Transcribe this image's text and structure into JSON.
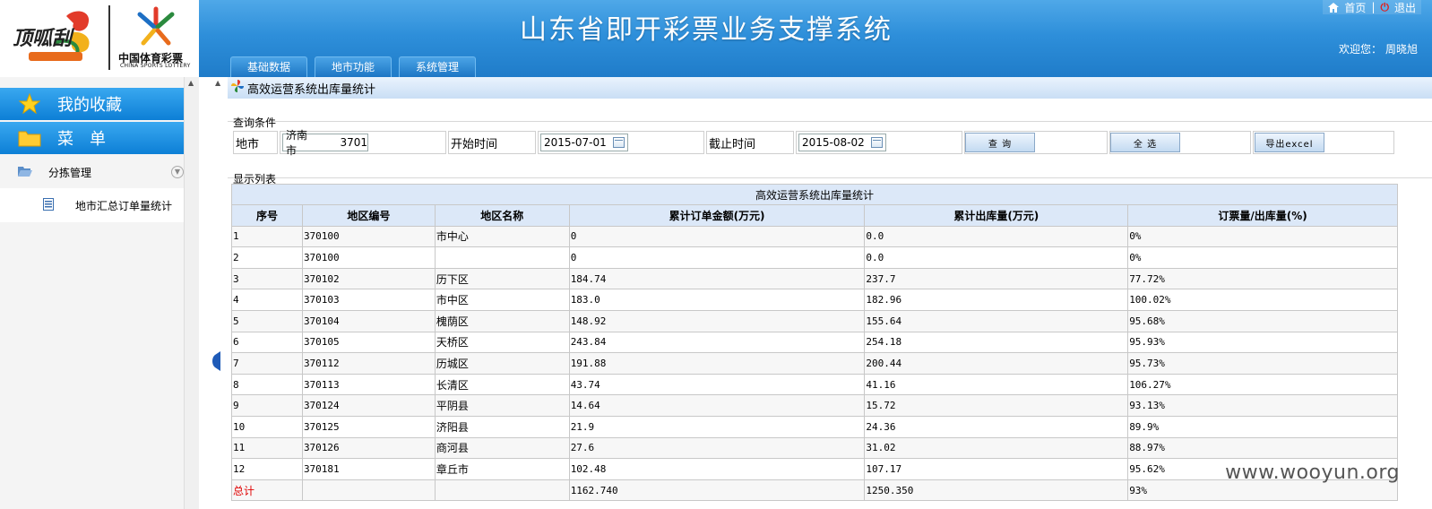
{
  "header": {
    "app_title": "山东省即开彩票业务支撑系统",
    "logo_lottery_cn": "中国体育彩票",
    "logo_lottery_en": "CHINA SPORTS LOTTERY",
    "top_links": {
      "home": "首页",
      "sep": "|",
      "logout": "退出"
    },
    "welcome_label": "欢迎您：",
    "user_name": "周晓旭",
    "nav_tabs": [
      "基础数据",
      "地市功能",
      "系统管理"
    ]
  },
  "sidebar": {
    "favorites_label": "我的收藏",
    "menu_label": "菜　单",
    "group_label": "分拣管理",
    "leaf_label": "地市汇总订单量统计"
  },
  "page": {
    "title": "高效运营系统出库量统计",
    "query_legend": "查询条件",
    "list_legend": "显示列表"
  },
  "query": {
    "city_label": "地市",
    "city_value_name": "济南市",
    "city_value_code": "3701",
    "start_label": "开始时间",
    "start_value": "2015-07-01",
    "end_label": "截止时间",
    "end_value": "2015-08-02",
    "search_button": "查 询",
    "select_all_button": "全 选",
    "export_button": "导出excel"
  },
  "table": {
    "caption": "高效运营系统出库量统计",
    "columns": [
      "序号",
      "地区编号",
      "地区名称",
      "累计订单金额(万元)",
      "累计出库量(万元)",
      "订票量/出库量(%)"
    ],
    "rows": [
      [
        "1",
        "370100",
        "市中心",
        "0",
        "0.0",
        "0%"
      ],
      [
        "2",
        "370100",
        "",
        "0",
        "0.0",
        "0%"
      ],
      [
        "3",
        "370102",
        "历下区",
        "184.74",
        "237.7",
        "77.72%"
      ],
      [
        "4",
        "370103",
        "市中区",
        "183.0",
        "182.96",
        "100.02%"
      ],
      [
        "5",
        "370104",
        "槐荫区",
        "148.92",
        "155.64",
        "95.68%"
      ],
      [
        "6",
        "370105",
        "天桥区",
        "243.84",
        "254.18",
        "95.93%"
      ],
      [
        "7",
        "370112",
        "历城区",
        "191.88",
        "200.44",
        "95.73%"
      ],
      [
        "8",
        "370113",
        "长清区",
        "43.74",
        "41.16",
        "106.27%"
      ],
      [
        "9",
        "370124",
        "平阴县",
        "14.64",
        "15.72",
        "93.13%"
      ],
      [
        "10",
        "370125",
        "济阳县",
        "21.9",
        "24.36",
        "89.9%"
      ],
      [
        "11",
        "370126",
        "商河县",
        "27.6",
        "31.02",
        "88.97%"
      ],
      [
        "12",
        "370181",
        "章丘市",
        "102.48",
        "107.17",
        "95.62%"
      ]
    ],
    "total": {
      "label": "总计",
      "order_amount": "1162.740",
      "outbound": "1250.350",
      "ratio": "93%"
    }
  },
  "watermark": "www.wooyun.org",
  "colors": {
    "header_blue": "#2e8fda",
    "side_header_blue": "#1a8ae0",
    "total_red": "#e00000"
  }
}
